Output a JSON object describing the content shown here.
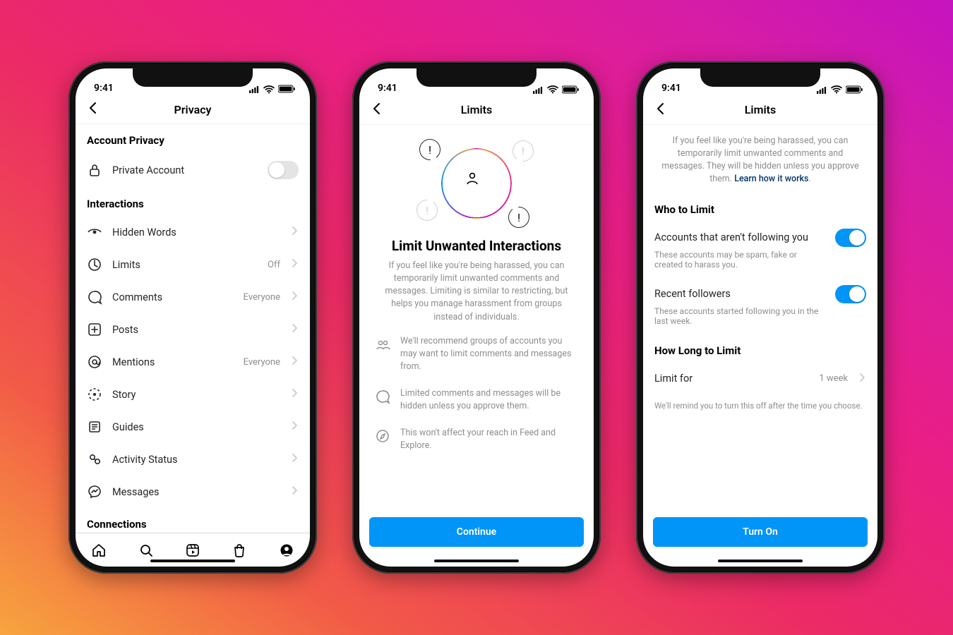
{
  "status": {
    "time": "9:41"
  },
  "phone1": {
    "title": "Privacy",
    "section_account": "Account Privacy",
    "private_account": "Private Account",
    "section_interactions": "Interactions",
    "rows": [
      {
        "label": "Hidden Words",
        "value": ""
      },
      {
        "label": "Limits",
        "value": "Off"
      },
      {
        "label": "Comments",
        "value": "Everyone"
      },
      {
        "label": "Posts",
        "value": ""
      },
      {
        "label": "Mentions",
        "value": "Everyone"
      },
      {
        "label": "Story",
        "value": ""
      },
      {
        "label": "Guides",
        "value": ""
      },
      {
        "label": "Activity Status",
        "value": ""
      },
      {
        "label": "Messages",
        "value": ""
      }
    ],
    "section_connections": "Connections"
  },
  "phone2": {
    "title": "Limits",
    "heading": "Limit Unwanted Interactions",
    "body": "If you feel like you're being harassed, you can temporarily limit unwanted comments and messages. Limiting is similar to restricting, but helps you manage harassment from groups instead of individuals.",
    "bullets": [
      "We'll recommend groups of accounts you may want to limit comments and messages from.",
      "Limited comments and messages will be hidden unless you approve them.",
      "This won't affect your reach in Feed and Explore."
    ],
    "cta": "Continue"
  },
  "phone3": {
    "title": "Limits",
    "intro": "If you feel like you're being harassed, you can temporarily limit unwanted comments and messages. They will be hidden unless you approve them.",
    "learn": "Learn how it works",
    "section_who": "Who to Limit",
    "opt1_title": "Accounts that aren't following you",
    "opt1_desc": "These accounts may be spam, fake or created to harass you.",
    "opt2_title": "Recent followers",
    "opt2_desc": "These accounts started following you in the last week.",
    "section_how": "How Long to Limit",
    "limit_for_label": "Limit for",
    "limit_for_value": "1 week",
    "hint": "We'll remind you to turn this off after the time you choose.",
    "cta": "Turn On"
  }
}
